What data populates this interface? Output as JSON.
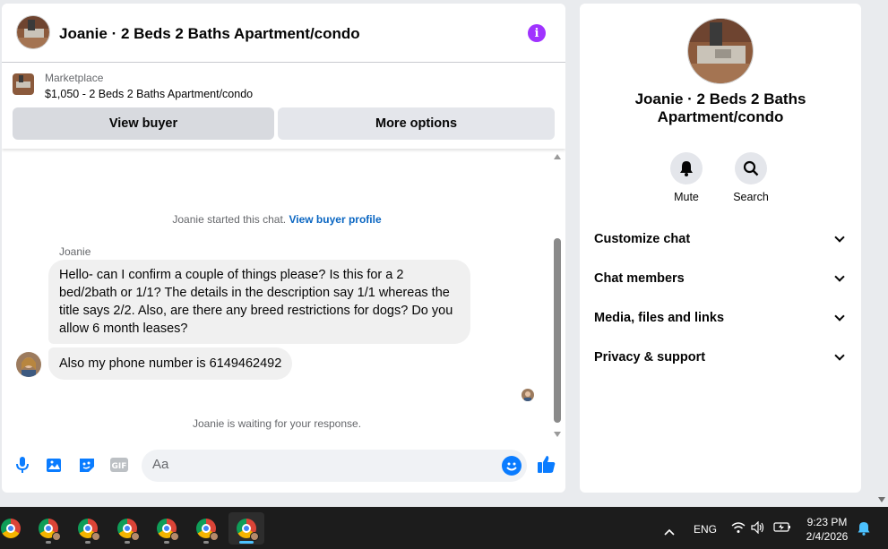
{
  "chat": {
    "title": "Joanie · 2 Beds 2 Baths Apartment/condo",
    "marketplace_label": "Marketplace",
    "listing": "$1,050 - 2 Beds 2 Baths Apartment/condo",
    "view_buyer": "View buyer",
    "more_options": "More options",
    "started_text": "Joanie started this chat.",
    "view_buyer_profile": "View buyer profile",
    "sender": "Joanie",
    "messages": [
      "Hello- can I confirm a couple of things please? Is this for a 2 bed/2bath or 1/1? The details in the description say 1/1 whereas the title says 2/2. Also, are there any breed restrictions for dogs? Do you allow 6 month leases?",
      "Also my phone number is 6149462492"
    ],
    "waiting_text": "Joanie is waiting for your response.",
    "input_placeholder": "Aa"
  },
  "info": {
    "title": "Joanie · 2 Beds 2 Baths Apartment/condo",
    "actions": [
      "Mute",
      "Search"
    ],
    "sections": [
      "Customize chat",
      "Chat members",
      "Media, files and links",
      "Privacy & support"
    ]
  },
  "taskbar": {
    "tray_lang": "ENG",
    "time": "9:23 PM",
    "date": "2/4/2026"
  },
  "colors": {
    "accent": "#0a7cff",
    "info_purple": "#a033ff",
    "link_blue": "#0a66c2"
  }
}
